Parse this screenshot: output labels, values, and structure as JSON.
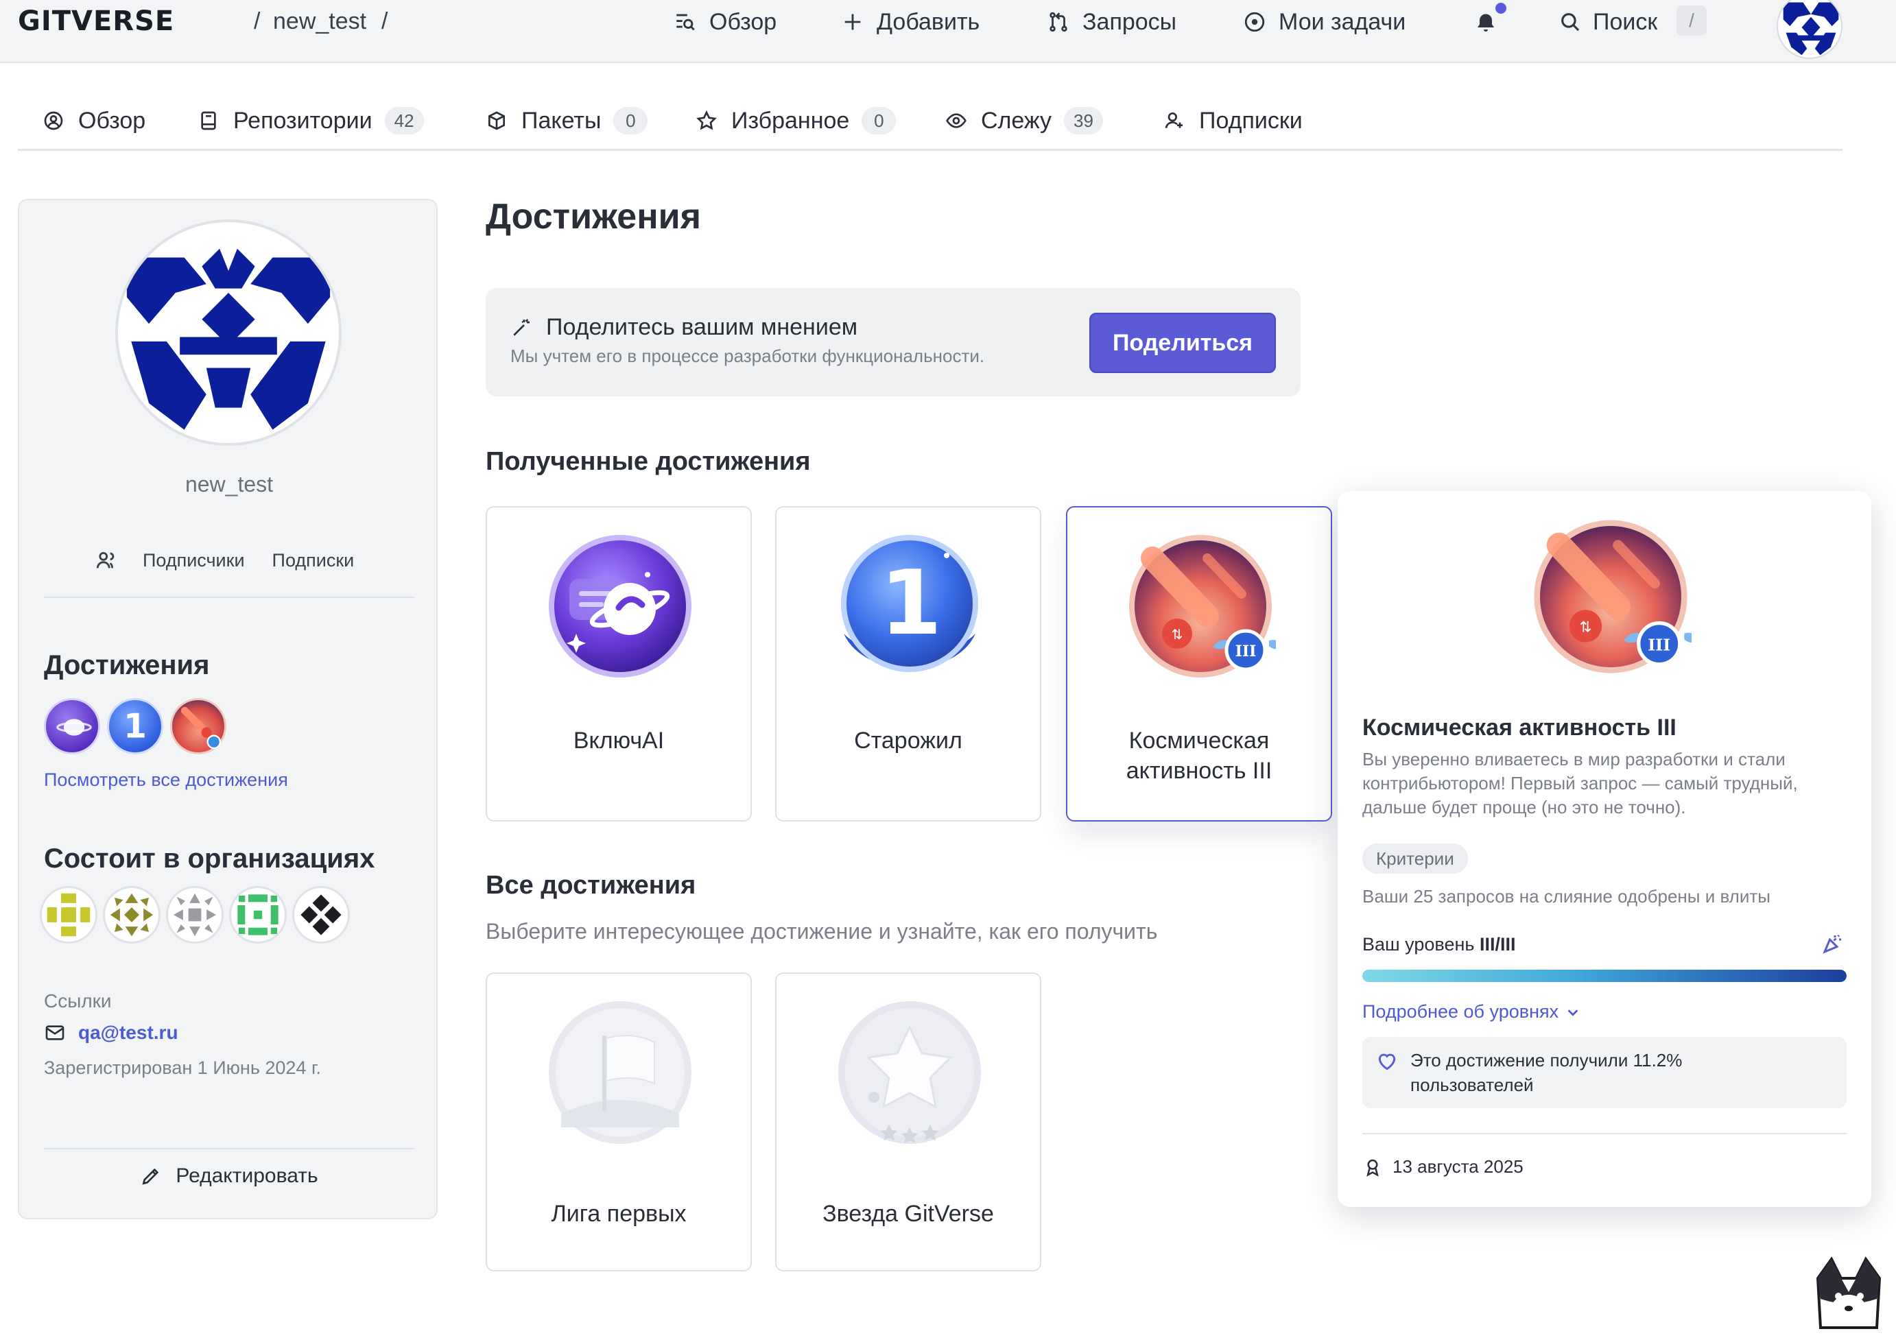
{
  "header": {
    "logo": "GITVERSE",
    "breadcrumb_sep1": "/",
    "breadcrumb_user": "new_test",
    "breadcrumb_sep2": "/",
    "nav": {
      "overview": "Обзор",
      "add": "Добавить",
      "requests": "Запросы",
      "my_tasks": "Мои задачи"
    },
    "search": "Поиск",
    "search_hotkey": "/"
  },
  "tabs": {
    "overview": "Обзор",
    "repos": "Репозитории",
    "repos_count": "42",
    "packages": "Пакеты",
    "packages_count": "0",
    "favorites": "Избранное",
    "favorites_count": "0",
    "watching": "Слежу",
    "watching_count": "39",
    "subscriptions": "Подписки"
  },
  "sidebar": {
    "username": "new_test",
    "followers": "Подписчики",
    "following": "Подписки",
    "achievements_title": "Достижения",
    "see_all": "Посмотреть все достижения",
    "orgs_title": "Состоит в организациях",
    "links_title": "Ссылки",
    "email": "qa@test.ru",
    "registered": "Зарегистрирован 1 Июнь 2024 г.",
    "edit": "Редактировать"
  },
  "main": {
    "title": "Достижения",
    "feedback": {
      "title": "Поделитесь вашим мнением",
      "subtitle": "Мы учтем его в процессе разработки функциональности.",
      "button": "Поделиться"
    },
    "received_title": "Полученные достижения",
    "received": [
      {
        "label": "ВключAI"
      },
      {
        "label": "Старожил"
      },
      {
        "label": "Космическая активность III"
      }
    ],
    "all_title": "Все достижения",
    "all_subtitle": "Выберите интересующее достижение и узнайте, как его получить",
    "all": [
      {
        "label": "Лига первых"
      },
      {
        "label": "Звезда GitVerse"
      }
    ]
  },
  "popover": {
    "title": "Космическая активность III",
    "description": "Вы уверенно вливаетесь в мир разработки и стали контрибьютором! Первый запрос — самый трудный, дальше будет проще (но это не точно).",
    "criteria_chip": "Критерии",
    "criteria": "Ваши 25 запросов на слияние одобрены и влиты",
    "level_label": "Ваш уровень",
    "level_value": "III/III",
    "level_progress": 1.0,
    "more_levels": "Подробнее об уровнях",
    "stat": "Это достижение получили 11.2% пользователей",
    "date": "13 августа 2025"
  },
  "colors": {
    "accent": "#5b5bd6",
    "link": "#4c5bd4",
    "avatar_blue": "#0b1f9a"
  }
}
